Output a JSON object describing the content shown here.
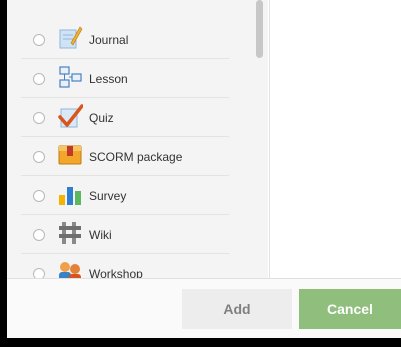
{
  "activities": [
    {
      "label": "Journal",
      "icon": "journal-icon"
    },
    {
      "label": "Lesson",
      "icon": "lesson-icon"
    },
    {
      "label": "Quiz",
      "icon": "quiz-icon"
    },
    {
      "label": "SCORM package",
      "icon": "scorm-package-icon"
    },
    {
      "label": "Survey",
      "icon": "survey-icon"
    },
    {
      "label": "Wiki",
      "icon": "wiki-icon"
    },
    {
      "label": "Workshop",
      "icon": "workshop-icon"
    }
  ],
  "footer": {
    "add_label": "Add",
    "cancel_label": "Cancel"
  },
  "colors": {
    "cancel_button": "#8fbe7d",
    "add_button": "#ededed"
  }
}
